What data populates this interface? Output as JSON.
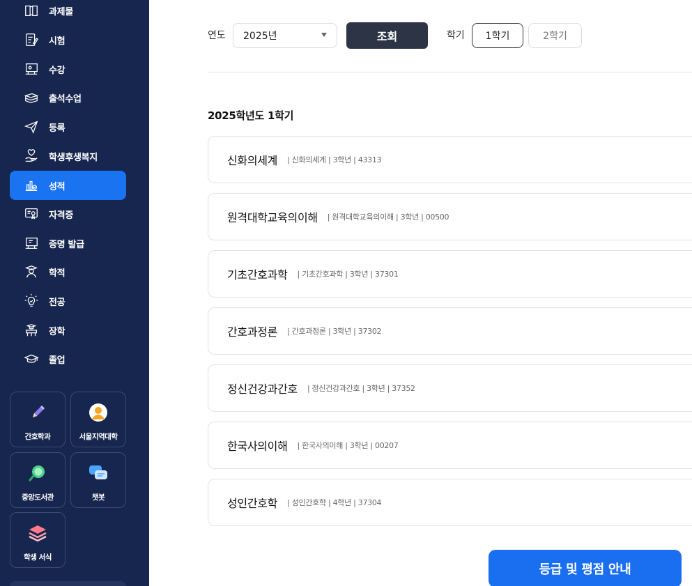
{
  "sidebar": {
    "items": [
      {
        "label": "과제물",
        "icon": "book-icon"
      },
      {
        "label": "시험",
        "icon": "exam-paper-icon"
      },
      {
        "label": "수강",
        "icon": "lecture-screen-icon"
      },
      {
        "label": "출석수업",
        "icon": "books-stack-icon"
      },
      {
        "label": "등록",
        "icon": "paper-plane-icon"
      },
      {
        "label": "학생후생복지",
        "icon": "hand-heart-icon"
      },
      {
        "label": "성적",
        "icon": "grade-chart-icon"
      },
      {
        "label": "자격증",
        "icon": "certificate-icon"
      },
      {
        "label": "증명 발급",
        "icon": "document-issue-icon"
      },
      {
        "label": "학적",
        "icon": "student-icon"
      },
      {
        "label": "전공",
        "icon": "lightbulb-icon"
      },
      {
        "label": "장학",
        "icon": "scholarship-icon"
      },
      {
        "label": "졸업",
        "icon": "graduation-cap-icon"
      }
    ],
    "active_index": 6,
    "tiles": [
      {
        "label": "간호학과",
        "icon": "pen-icon"
      },
      {
        "label": "서울지역대학",
        "icon": "person-icon"
      },
      {
        "label": "중앙도서관",
        "icon": "magnifier-icon"
      },
      {
        "label": "챗봇",
        "icon": "chat-bubbles-icon"
      },
      {
        "label": "학생 서식",
        "icon": "layers-icon"
      }
    ]
  },
  "filters": {
    "year_label": "연도",
    "year_value": "2025년",
    "search_label": "조회",
    "semester_label": "학기",
    "semester_options": [
      "1학기",
      "2학기"
    ],
    "semester_selected": "1학기"
  },
  "section_title": "2025학년도 1학기",
  "courses": [
    {
      "name": "신화의세계",
      "meta": "| 신화의세계 | 3학년 | 43313"
    },
    {
      "name": "원격대학교육의이해",
      "meta": "| 원격대학교육의이해 | 3학년 | 00500"
    },
    {
      "name": "기초간호과학",
      "meta": "| 기초간호과학 | 3학년 | 37301"
    },
    {
      "name": "간호과정론",
      "meta": "| 간호과정론 | 3학년 | 37302"
    },
    {
      "name": "정신건강과간호",
      "meta": "| 정신건강과간호 | 3학년 | 37352"
    },
    {
      "name": "한국사의이해",
      "meta": "| 한국사의이해 | 3학년 | 00207"
    },
    {
      "name": "성인간호학",
      "meta": "| 성인간호학 | 4학년 | 37304"
    }
  ],
  "guide_button": "등급 및 평점 안내",
  "colors": {
    "sidebar_bg": "#17264e",
    "active_item": "#1a73f0",
    "search_button": "#2c3446",
    "guide_button": "#1a6ff0"
  }
}
